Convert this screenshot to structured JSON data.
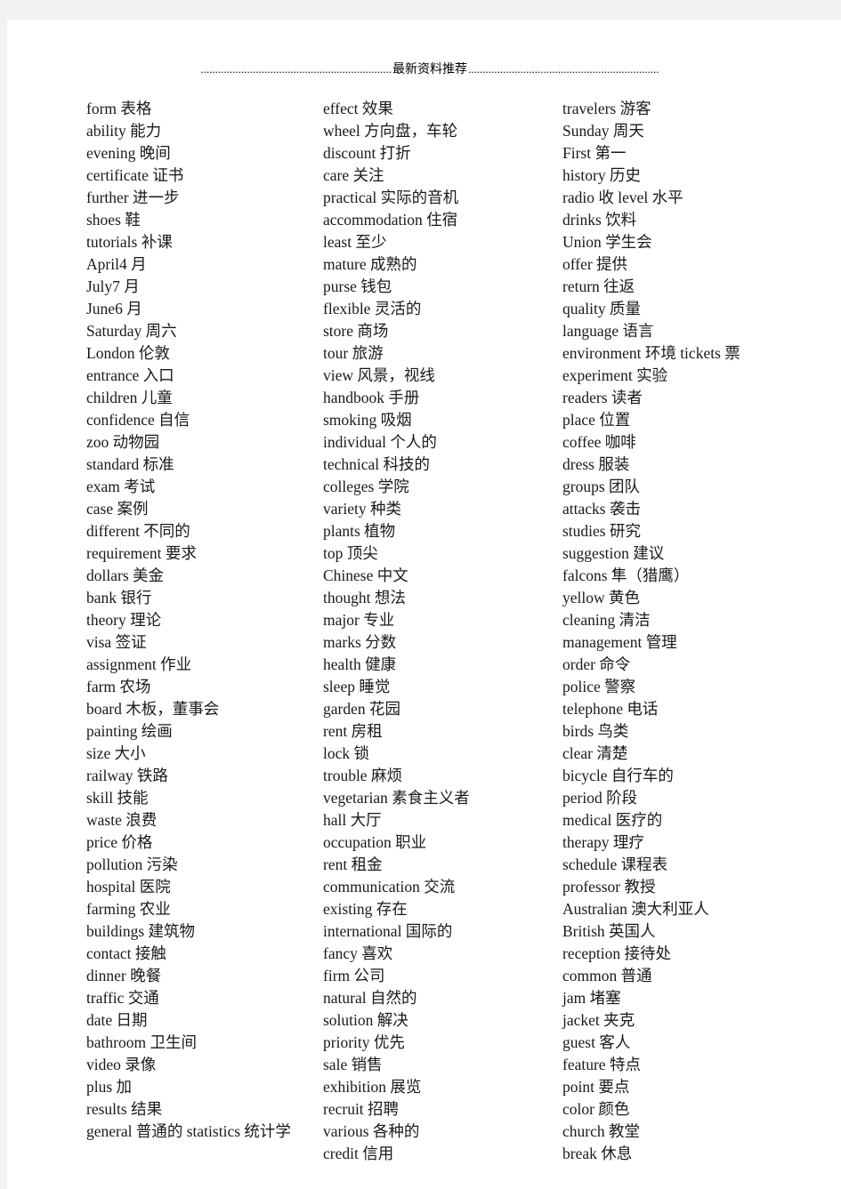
{
  "header": {
    "title": "最新资料推荐",
    "dots_left": "..................................................................",
    "dots_right": ".................................................................."
  },
  "columns": [
    {
      "name": "column-1",
      "entries": [
        "form  表格",
        "ability  能力",
        "evening  晚间",
        "certificate  证书",
        "further  进一步",
        "shoes  鞋",
        "tutorials 补课",
        "April4 月",
        "July7 月",
        "June6 月",
        "Saturday 周六",
        "London  伦敦",
        "entrance  入口",
        "children  儿童",
        "confidence  自信",
        "zoo  动物园",
        "standard  标准",
        "exam  考试",
        "case  案例",
        "different  不同的",
        "requirement  要求",
        "dollars  美金",
        "bank  银行",
        "theory  理论",
        "visa  签证",
        "assignment  作业",
        "farm  农场",
        "board  木板，董事会",
        "painting  绘画",
        "size  大小",
        "railway  铁路",
        "skill  技能",
        "waste  浪费",
        "price  价格",
        "pollution  污染",
        "hospital  医院",
        "farming  农业",
        "buildings  建筑物",
        "contact  接触",
        "dinner  晚餐",
        "traffic  交通",
        "date  日期",
        "bathroom  卫生间",
        "video  录像",
        "plus  加",
        "results  结果",
        "general  普通的  statistics  统计学"
      ]
    },
    {
      "name": "column-2",
      "entries": [
        "effect  效果",
        "wheel  方向盘，车轮",
        "discount  打折",
        "care  关注",
        "practical  实际的音机",
        "accommodation  住宿",
        "least  至少",
        "mature  成熟的",
        "purse  钱包",
        "flexible  灵活的",
        "store  商场",
        "tour  旅游",
        "view  风景，视线",
        "handbook  手册",
        "smoking  吸烟",
        "individual  个人的",
        "technical  科技的",
        "colleges  学院",
        "variety  种类",
        "plants  植物",
        "top  顶尖",
        "Chinese  中文",
        "thought  想法",
        "major  专业",
        "marks  分数",
        "health  健康",
        "sleep  睡觉",
        "garden  花园",
        "rent  房租",
        "lock  锁",
        "trouble  麻烦",
        "vegetarian  素食主义者",
        "hall  大厅",
        "occupation  职业",
        "rent  租金",
        "communication  交流",
        "existing  存在",
        "international  国际的",
        "fancy  喜欢",
        "firm  公司",
        "natural  自然的",
        "solution  解决",
        "priority  优先",
        "sale  销售",
        "exhibition  展览",
        "recruit  招聘",
        "various  各种的",
        "credit  信用"
      ]
    },
    {
      "name": "column-3",
      "entries": [
        "travelers  游客",
        "Sunday 周天",
        "First 第一",
        "history  历史",
        "radio  收 level  水平",
        "drinks  饮料",
        "Union  学生会",
        "offer  提供",
        "return  往返",
        "quality  质量",
        "language  语言",
        "environment  环境 tickets  票",
        "experiment  实验",
        "readers  读者",
        "place  位置",
        "coffee  咖啡",
        "dress  服装",
        "groups  团队",
        "attacks  袭击",
        "studies  研究",
        "suggestion  建议",
        "falcons  隼（猎鹰）",
        "yellow  黄色",
        "cleaning  清洁",
        "management  管理",
        "order  命令",
        "police  警察",
        "telephone  电话",
        "birds  鸟类",
        "clear  清楚",
        "bicycle  自行车的",
        "period  阶段",
        "medical  医疗的",
        "therapy  理疗",
        "schedule  课程表",
        "professor  教授",
        "Australian 澳大利亚人",
        "British 英国人",
        "reception  接待处",
        "common  普通",
        "jam  堵塞",
        "jacket  夹克",
        "guest  客人",
        "feature  特点",
        "point  要点",
        "color  颜色",
        "church  教堂",
        "break  休息"
      ]
    }
  ]
}
